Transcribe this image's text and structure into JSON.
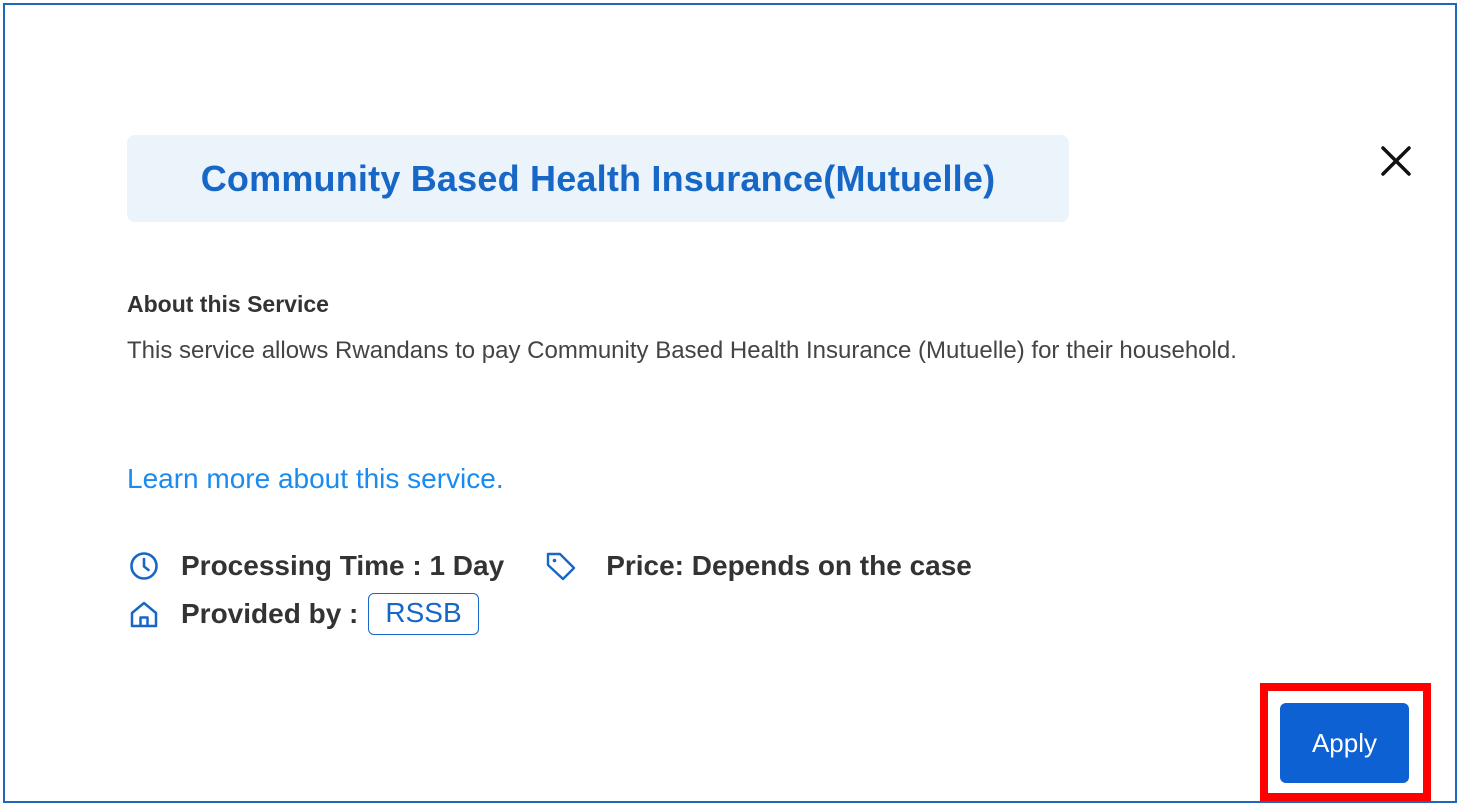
{
  "dialog": {
    "title": "Community Based Health Insurance(Mutuelle)",
    "about_heading": "About this Service",
    "about_text": "This service allows Rwandans to pay Community Based Health Insurance (Mutuelle) for their household.",
    "learn_more": "Learn more about this service.",
    "processing_time": "Processing Time : 1 Day",
    "price": "Price: Depends on the case",
    "provided_by_label": "Provided by :",
    "provider": "RSSB",
    "apply_label": "Apply"
  },
  "icons": {
    "close": "close-icon",
    "clock": "clock-icon",
    "tag": "tag-icon",
    "home": "home-icon"
  },
  "colors": {
    "accent": "#1767c7",
    "link": "#1a8bef",
    "title_bg": "#ebf3fb",
    "button_bg": "#0d61d2",
    "highlight": "#ff0000",
    "frame_border": "#1f67bd"
  }
}
